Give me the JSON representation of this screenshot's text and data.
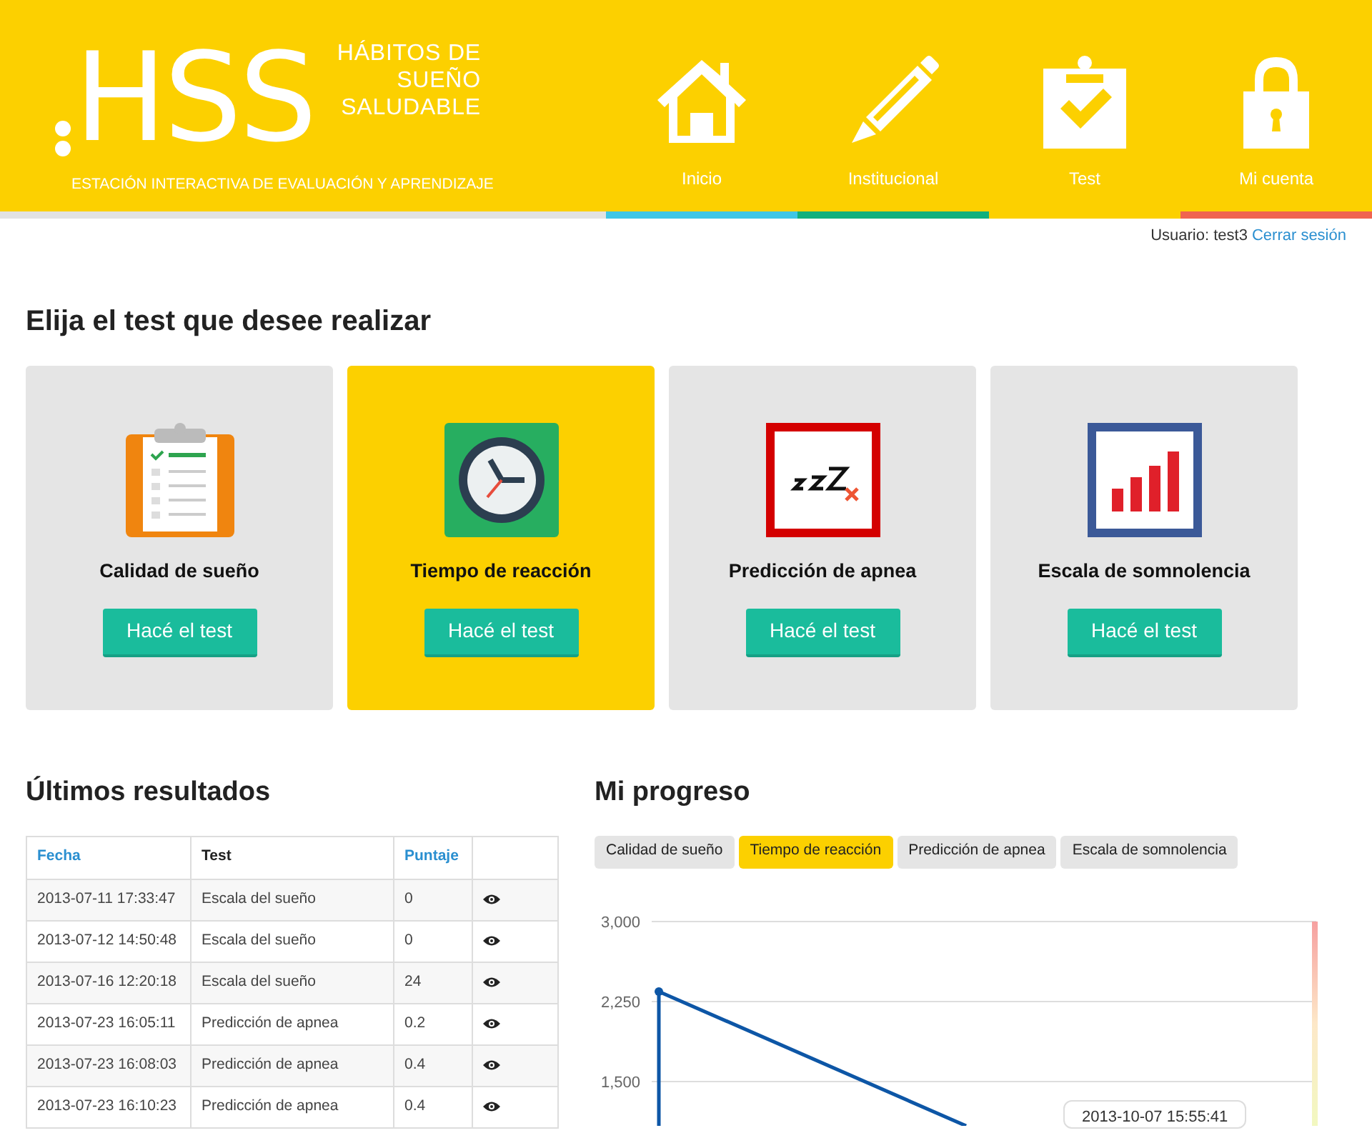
{
  "header": {
    "logo": "HSS",
    "title_lines": [
      "HÁBITOS DE",
      "SUEÑO",
      "SALUDABLE"
    ],
    "tagline": "ESTACIÓN INTERACTIVA DE EVALUACIÓN Y APRENDIZAJE",
    "nav": [
      {
        "kind": "house",
        "label": "Inicio",
        "color": "#3ec6e6"
      },
      {
        "kind": "pencil",
        "label": "Institucional",
        "color": "#10b07d"
      },
      {
        "kind": "clipboard",
        "label": "Test",
        "color": "#fcd000"
      },
      {
        "kind": "lock",
        "label": "Mi cuenta",
        "color": "#f06450"
      }
    ]
  },
  "user_bar": {
    "user": "Usuario: test3",
    "logout": "Cerrar sesión"
  },
  "tests": {
    "heading": "Elija el test que desee realizar",
    "cards": [
      {
        "kind": "clipboard",
        "title": "Calidad de sueño",
        "button": "Hacé el test",
        "selected": false
      },
      {
        "kind": "clock",
        "title": "Tiempo de reacción",
        "button": "Hacé el test",
        "selected": true
      },
      {
        "kind": "zzz",
        "title": "Predicción de apnea",
        "button": "Hacé el test",
        "selected": false
      },
      {
        "kind": "bars",
        "title": "Escala de somnolencia",
        "button": "Hacé el test",
        "selected": false
      }
    ]
  },
  "results": {
    "heading": "Últimos resultados",
    "columns": [
      "Fecha",
      "Test",
      "Puntaje"
    ],
    "rows": [
      {
        "date": "2013-07-11 17:33:47",
        "test": "Escala del sueño",
        "score": "0"
      },
      {
        "date": "2013-07-12 14:50:48",
        "test": "Escala del sueño",
        "score": "0"
      },
      {
        "date": "2013-07-16 12:20:18",
        "test": "Escala del sueño",
        "score": "24"
      },
      {
        "date": "2013-07-23 16:05:11",
        "test": "Predicción de apnea",
        "score": "0.2"
      },
      {
        "date": "2013-07-23 16:08:03",
        "test": "Predicción de apnea",
        "score": "0.4"
      },
      {
        "date": "2013-07-23 16:10:23",
        "test": "Predicción de apnea",
        "score": "0.4"
      }
    ]
  },
  "progress": {
    "heading": "Mi progreso",
    "tabs": [
      {
        "label": "Calidad de sueño",
        "selected": false
      },
      {
        "label": "Tiempo de reacción",
        "selected": true
      },
      {
        "label": "Predicción de apnea",
        "selected": false
      },
      {
        "label": "Escala de somnolencia",
        "selected": false
      }
    ],
    "tooltip": "2013-10-07 15:55:41",
    "chart": {
      "y_labels": [
        "3,000",
        "2,250",
        "1,500"
      ]
    }
  }
}
